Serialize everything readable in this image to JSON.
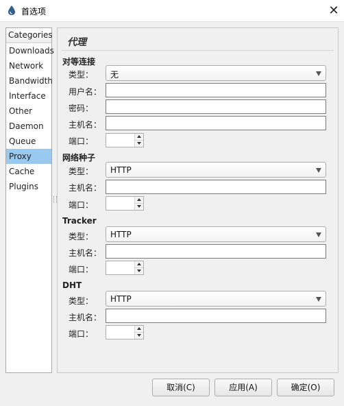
{
  "window": {
    "title": "首选项",
    "icon": "droplet-icon",
    "close_symbol": "✕"
  },
  "sidebar": {
    "header": "Categories",
    "items": [
      {
        "label": "Downloads",
        "selected": false
      },
      {
        "label": "Network",
        "selected": false
      },
      {
        "label": "Bandwidth",
        "selected": false
      },
      {
        "label": "Interface",
        "selected": false
      },
      {
        "label": "Other",
        "selected": false
      },
      {
        "label": "Daemon",
        "selected": false
      },
      {
        "label": "Queue",
        "selected": false
      },
      {
        "label": "Proxy",
        "selected": true
      },
      {
        "label": "Cache",
        "selected": false
      },
      {
        "label": "Plugins",
        "selected": false
      }
    ],
    "selected_color": "#99c9ef"
  },
  "panel": {
    "title": "代理",
    "groups": {
      "peer": {
        "label": "对等连接",
        "type_label": "类型：",
        "type_value": "无",
        "username_label": "用户名：",
        "username_value": "",
        "password_label": "密码：",
        "password_value": "",
        "hostname_label": "主机名：",
        "hostname_value": "",
        "port_label": "端口：",
        "port_value": ""
      },
      "web_seed": {
        "label": "网络种子",
        "type_label": "类型：",
        "type_value": "HTTP",
        "hostname_label": "主机名：",
        "hostname_value": "",
        "port_label": "端口：",
        "port_value": ""
      },
      "tracker": {
        "label": "Tracker",
        "type_label": "类型：",
        "type_value": "HTTP",
        "hostname_label": "主机名：",
        "hostname_value": "",
        "port_label": "端口：",
        "port_value": ""
      },
      "dht": {
        "label": "DHT",
        "type_label": "类型：",
        "type_value": "HTTP",
        "hostname_label": "主机名：",
        "hostname_value": "",
        "port_label": "端口：",
        "port_value": ""
      }
    }
  },
  "buttons": {
    "cancel": "取消(C)",
    "apply": "应用(A)",
    "ok": "确定(O)"
  }
}
